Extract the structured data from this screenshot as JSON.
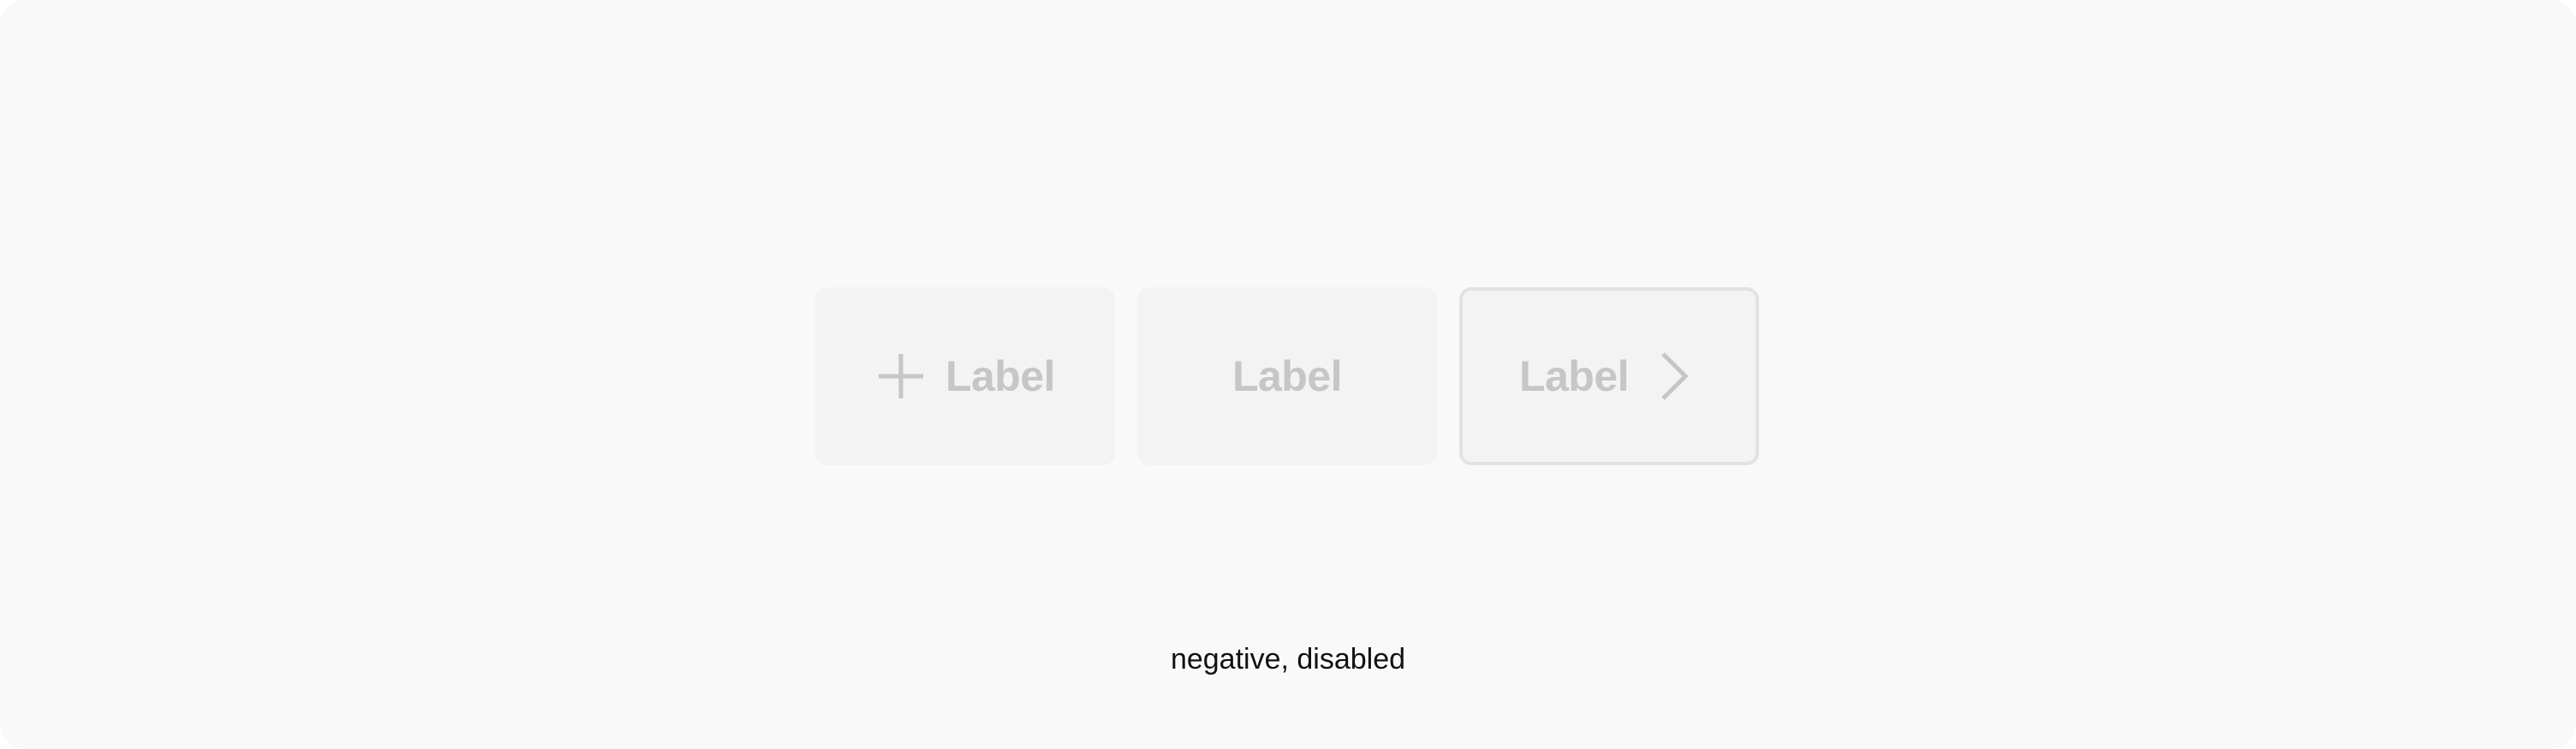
{
  "buttons": [
    {
      "label": "Label",
      "icon_left": "plus-icon",
      "variant": "filled",
      "state": "disabled"
    },
    {
      "label": "Label",
      "variant": "filled",
      "state": "disabled"
    },
    {
      "label": "Label",
      "icon_right": "chevron-right-icon",
      "variant": "outline",
      "state": "disabled"
    }
  ],
  "caption": "negative, disabled",
  "colors": {
    "background": "#f9f9f9",
    "button_fill": "#f3f3f3",
    "button_border": "#e2e2e2",
    "disabled_text": "#c6c6c6",
    "caption_text": "#111111"
  }
}
